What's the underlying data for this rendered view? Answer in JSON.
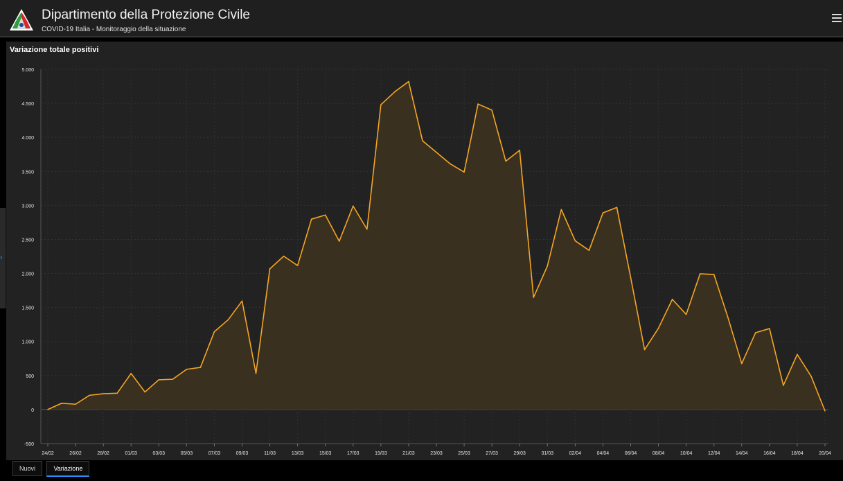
{
  "header": {
    "title": "Dipartimento della Protezione Civile",
    "subtitle": "COVID-19 Italia - Monitoraggio della situazione",
    "logo_icon": "protezione-civile-logo-icon",
    "menu_icon": "hamburger-menu-icon"
  },
  "panel": {
    "title": "Variazione totale positivi"
  },
  "tabs": [
    {
      "label": "Nuovi",
      "active": false
    },
    {
      "label": "Variazione",
      "active": true
    }
  ],
  "colors": {
    "line": "#f5a623",
    "fill": "#3d3220",
    "panel_bg": "#222222",
    "tab_accent": "#2a8fff"
  },
  "chart_data": {
    "type": "area",
    "title": "Variazione totale positivi",
    "ylim": [
      -500,
      5000
    ],
    "y_ticks": [
      "-500",
      "0",
      "500",
      "1.000",
      "1.500",
      "2.000",
      "2.500",
      "3.000",
      "3.500",
      "4.000",
      "4.500",
      "5.000"
    ],
    "x_tick_labels": [
      "24/02",
      "26/02",
      "28/02",
      "01/03",
      "03/03",
      "05/03",
      "07/03",
      "09/03",
      "11/03",
      "13/03",
      "15/03",
      "17/03",
      "19/03",
      "21/03",
      "23/03",
      "25/03",
      "27/03",
      "29/03",
      "31/03",
      "02/04",
      "04/04",
      "06/04",
      "08/04",
      "10/04",
      "12/04",
      "14/04",
      "16/04",
      "18/04",
      "20/04"
    ],
    "x": [
      "24/02",
      "25/02",
      "26/02",
      "27/02",
      "28/02",
      "29/02",
      "01/03",
      "02/03",
      "03/03",
      "04/03",
      "05/03",
      "06/03",
      "07/03",
      "08/03",
      "09/03",
      "10/03",
      "11/03",
      "12/03",
      "13/03",
      "14/03",
      "15/03",
      "16/03",
      "17/03",
      "18/03",
      "19/03",
      "20/03",
      "21/03",
      "22/03",
      "23/03",
      "24/03",
      "25/03",
      "26/03",
      "27/03",
      "28/03",
      "29/03",
      "30/03",
      "31/03",
      "01/04",
      "02/04",
      "03/04",
      "04/04",
      "05/04",
      "06/04",
      "07/04",
      "08/04",
      "09/04",
      "10/04",
      "11/04",
      "12/04",
      "13/04",
      "14/04",
      "15/04",
      "16/04",
      "17/04",
      "18/04",
      "19/04",
      "20/04"
    ],
    "series": [
      {
        "values": [
          0,
          93,
          78,
          209,
          233,
          240,
          531,
          258,
          438,
          446,
          591,
          620,
          1144,
          1320,
          1595,
          532,
          2068,
          2254,
          2116,
          2798,
          2859,
          2474,
          2991,
          2650,
          4480,
          4670,
          4820,
          3950,
          3780,
          3610,
          3490,
          4490,
          4400,
          3650,
          3810,
          1648,
          2110,
          2940,
          2480,
          2340,
          2890,
          2970,
          1940,
          880,
          1195,
          1620,
          1398,
          1995,
          1985,
          1358,
          675,
          1130,
          1190,
          355,
          810,
          490,
          -20
        ]
      }
    ],
    "grid": true,
    "legend": "none"
  }
}
